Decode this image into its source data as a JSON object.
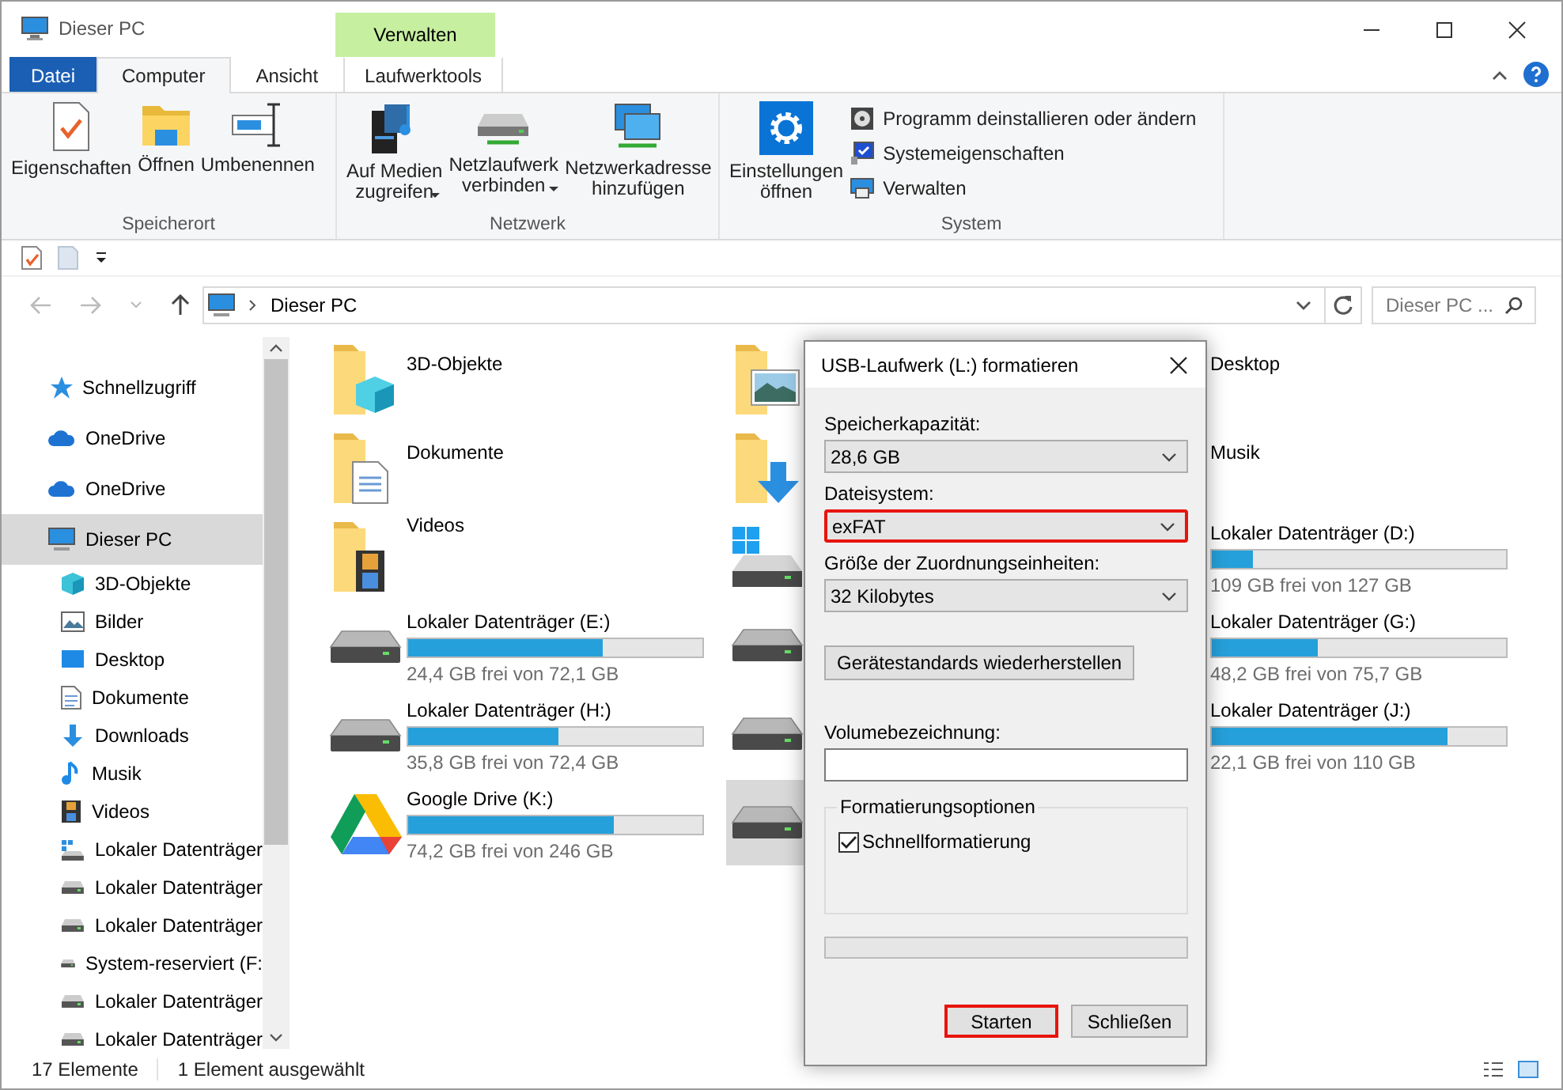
{
  "window": {
    "title": "Dieser PC"
  },
  "context_group": "Verwalten",
  "tabs": [
    {
      "label": "Datei",
      "kind": "file",
      "selected": false
    },
    {
      "label": "Computer",
      "kind": "tab",
      "selected": true
    },
    {
      "label": "Ansicht",
      "kind": "tab",
      "selected": false
    },
    {
      "label": "Laufwerktools",
      "kind": "context",
      "selected": false
    }
  ],
  "ribbon": {
    "groups": [
      {
        "label": "Speicherort",
        "buttons": [
          {
            "label": "Eigenschaften",
            "kind": "properties",
            "dropdown": false
          },
          {
            "label": "Öffnen",
            "kind": "open",
            "dropdown": false
          },
          {
            "label": "Umbenennen",
            "kind": "rename",
            "dropdown": false
          }
        ]
      },
      {
        "label": "Netzwerk",
        "buttons": [
          {
            "label": "Auf Medien\nzugreifen",
            "kind": "media",
            "dropdown": true
          },
          {
            "label": "Netzlaufwerk\nverbinden",
            "kind": "netdrive",
            "dropdown": true
          },
          {
            "label": "Netzwerkadresse\nhinzufügen",
            "kind": "netaddress",
            "dropdown": false
          }
        ]
      },
      {
        "label": "System",
        "buttons": [
          {
            "label": "Einstellungen\nöffnen",
            "kind": "settings",
            "dropdown": false
          }
        ],
        "small_buttons": [
          {
            "label": "Programm deinstallieren oder ändern",
            "kind": "uninstall"
          },
          {
            "label": "Systemeigenschaften",
            "kind": "sysprops"
          },
          {
            "label": "Verwalten",
            "kind": "manage"
          }
        ]
      }
    ]
  },
  "address": {
    "path": "Dieser PC",
    "search_placeholder": "Dieser PC ..."
  },
  "sidebar": {
    "items": [
      {
        "label": "Schnellzugriff",
        "kind": "star",
        "selected": false
      },
      {
        "label": "OneDrive",
        "kind": "cloud",
        "selected": false
      },
      {
        "label": "OneDrive",
        "kind": "cloud",
        "selected": false
      },
      {
        "label": "Dieser PC",
        "kind": "pc",
        "selected": true,
        "children": [
          {
            "label": "3D-Objekte",
            "kind": "cube",
            "selected": false
          },
          {
            "label": "Bilder",
            "kind": "pictures",
            "selected": false
          },
          {
            "label": "Desktop",
            "kind": "desktop",
            "selected": false
          },
          {
            "label": "Dokumente",
            "kind": "document",
            "selected": false
          },
          {
            "label": "Downloads",
            "kind": "download",
            "selected": false
          },
          {
            "label": "Musik",
            "kind": "music",
            "selected": false
          },
          {
            "label": "Videos",
            "kind": "video",
            "selected": false
          },
          {
            "label": "Lokaler Datenträger",
            "kind": "windows-drive",
            "selected": false
          },
          {
            "label": "Lokaler Datenträger",
            "kind": "drive",
            "selected": false
          },
          {
            "label": "Lokaler Datenträger",
            "kind": "drive",
            "selected": false
          },
          {
            "label": "System-reserviert (F:",
            "kind": "drive",
            "selected": false
          },
          {
            "label": "Lokaler Datenträger",
            "kind": "drive",
            "selected": false
          },
          {
            "label": "Lokaler Datenträger",
            "kind": "drive",
            "selected": false
          }
        ]
      }
    ]
  },
  "content": {
    "columns": [
      [
        {
          "kind": "folder-cube",
          "name": "3D-Objekte",
          "selected": false
        },
        {
          "kind": "folder-document",
          "name": "Dokumente",
          "selected": false
        },
        {
          "kind": "folder-video",
          "name": "Videos",
          "selected": false
        },
        {
          "kind": "drive",
          "name": "Lokaler Datenträger (E:)",
          "level": 0.66,
          "free": "24,4 GB frei von 72,1 GB",
          "selected": false
        },
        {
          "kind": "drive",
          "name": "Lokaler Datenträger (H:)",
          "level": 0.51,
          "free": "35,8 GB frei von 72,4 GB",
          "selected": false
        },
        {
          "kind": "gdrive",
          "name": "Google Drive (K:)",
          "level": 0.7,
          "free": "74,2 GB frei von 246 GB",
          "selected": false
        }
      ],
      [
        {
          "kind": "folder-pictures",
          "selected": false
        },
        {
          "kind": "folder-download",
          "selected": false
        },
        {
          "kind": "windows-drive",
          "selected": false
        },
        {
          "kind": "drive",
          "selected": false
        },
        {
          "kind": "drive",
          "selected": false
        },
        {
          "kind": "drive",
          "selected": true
        }
      ],
      [
        {
          "name": "Desktop",
          "selected": false
        },
        {
          "name": "Musik",
          "selected": false
        },
        {
          "name": "Lokaler Datenträger (D:)",
          "level": 0.14,
          "free": "109 GB frei von 127 GB",
          "selected": false
        },
        {
          "name": "Lokaler Datenträger (G:)",
          "level": 0.36,
          "free": "48,2 GB frei von 75,7 GB",
          "selected": false
        },
        {
          "name": "Lokaler Datenträger (J:)",
          "level": 0.8,
          "free": "22,1 GB frei von 110 GB",
          "selected": false
        }
      ]
    ]
  },
  "dialog": {
    "title": "USB-Laufwerk (L:) formatieren",
    "capacity": {
      "label": "Speicherkapazität:",
      "value": "28,6 GB",
      "highlighted": false
    },
    "filesystem": {
      "label": "Dateisystem:",
      "value": "exFAT",
      "highlighted": true
    },
    "unit_size": {
      "label": "Größe der Zuordnungseinheiten:",
      "value": "32 Kilobytes",
      "highlighted": false
    },
    "restore_button": "Gerätestandards wiederherstellen",
    "volume_label": {
      "label": "Volumebezeichnung:"
    },
    "options": {
      "legend": "Formatierungsoptionen",
      "quick_format": {
        "label": "Schnellformatierung",
        "checked": true
      }
    },
    "progress": {
      "level": 0
    },
    "buttons": [
      {
        "label": "Starten",
        "highlighted": true
      },
      {
        "label": "Schließen",
        "highlighted": false
      }
    ]
  },
  "status_bar": {
    "count": "17 Elemente",
    "selection": "1 Element ausgewählt"
  }
}
